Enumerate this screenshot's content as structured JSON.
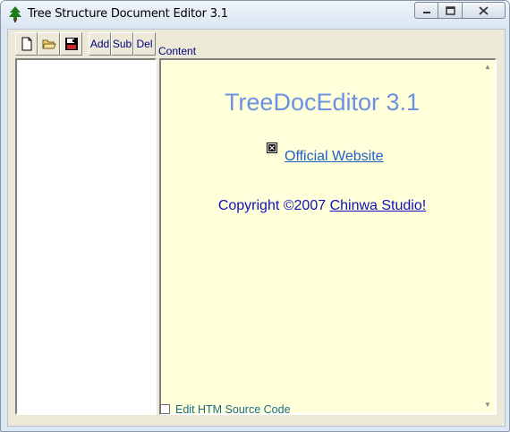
{
  "window": {
    "title": "Tree Structure Document Editor 3.1"
  },
  "toolbar": {
    "add_label": "Add",
    "sub_label": "Sub",
    "del_label": "Del"
  },
  "content": {
    "label": "Content",
    "doc_title": "TreeDocEditor 3.1",
    "website_link": "Official Website",
    "copyright_prefix": "Copyright ©2007 ",
    "copyright_link": "Chinwa Studio!"
  },
  "footer": {
    "edit_source_label": "Edit HTM Source Code",
    "edit_source_checked": false
  },
  "colors": {
    "content_background": "#ffffd9",
    "title_color": "#6a91e4",
    "link_color": "#1f5fc7"
  }
}
